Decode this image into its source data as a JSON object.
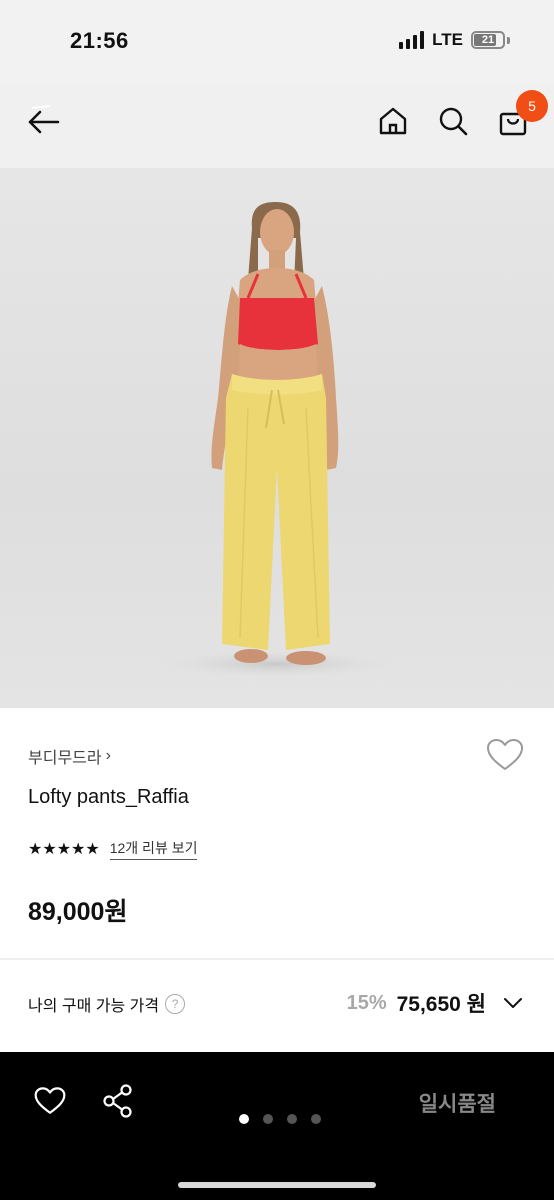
{
  "status_bar": {
    "time": "21:56",
    "network": "LTE",
    "battery": "21"
  },
  "header": {
    "cart_count": "5",
    "icons": [
      "back-arrow-icon",
      "home-icon",
      "search-icon",
      "shopping-bag-icon"
    ]
  },
  "product": {
    "brand": "부디무드라",
    "brand_chevron": "›",
    "name": "Lofty pants_Raffia",
    "rating": 5,
    "stars": "★★★★★",
    "review_link": "12개 리뷰 보기",
    "price": "89,000원"
  },
  "my_price": {
    "label": "나의 구매 가능 가격",
    "help": "?",
    "discount": "15%",
    "price": "75,650 원"
  },
  "bottom_bar": {
    "soldout_label": "일시품절",
    "image_count": 4,
    "active_image": 1
  },
  "colors": {
    "badge": "#f04e14",
    "bottom_bar_bg": "#000000",
    "top_color": "#e8323b",
    "pants_color": "#ecd770"
  }
}
